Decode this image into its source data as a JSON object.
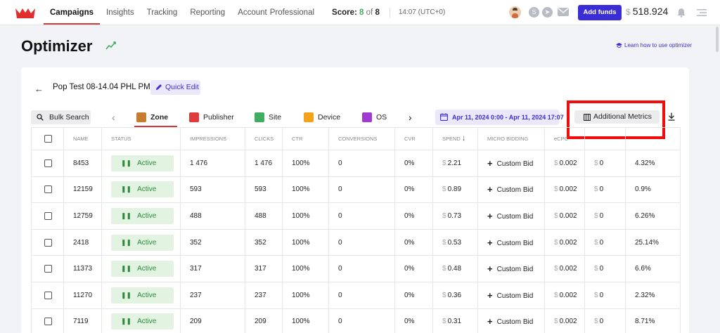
{
  "nav": {
    "items": [
      {
        "label": "Campaigns",
        "active": true
      },
      {
        "label": "Insights",
        "active": false
      },
      {
        "label": "Tracking",
        "active": false
      },
      {
        "label": "Reporting",
        "active": false
      }
    ],
    "account": {
      "label": "Account",
      "sub": "Professional"
    },
    "score": {
      "label": "Score:",
      "value": "8",
      "of": "of",
      "total": "8"
    },
    "time": "14:07 (UTC+0)",
    "social_icons": [
      "avatar",
      "skype-icon",
      "telegram-icon",
      "mail-icon"
    ],
    "add_funds_label": "Add funds",
    "balance": {
      "currency": "$",
      "amount": "518.924"
    },
    "accent_color": "#3b2dd6"
  },
  "page": {
    "title": "Optimizer",
    "learn_link": "Learn how to use optimizer"
  },
  "campaign": {
    "name": "Pop Test 08-14.04 PHL PM",
    "quick_edit_label": "Quick Edit"
  },
  "toolbar": {
    "bulk_search_label": "Bulk Search",
    "tabs": [
      {
        "label": "Zone",
        "icon": "zone-icon",
        "color": "#c77d2e",
        "active": true
      },
      {
        "label": "Publisher",
        "icon": "publisher-icon",
        "color": "#e03a3a",
        "active": false
      },
      {
        "label": "Site",
        "icon": "site-icon",
        "color": "#3fae62",
        "active": false
      },
      {
        "label": "Device",
        "icon": "device-icon",
        "color": "#f3a21b",
        "active": false
      },
      {
        "label": "OS",
        "icon": "os-icon",
        "color": "#a03ad0",
        "active": false
      }
    ],
    "date_range": "Apr 11, 2024 0:00 - Apr 11, 2024 17:07",
    "additional_metrics_label": "Additional Metrics",
    "highlight_color": "#f20d0d"
  },
  "table": {
    "headers": [
      "NAME",
      "STATUS",
      "IMPRESSIONS",
      "CLICKS",
      "CTR",
      "CONVERSIONS",
      "CVR",
      "SPEND",
      "MICRO BIDDING",
      "eCPC",
      "",
      ""
    ],
    "rows": [
      {
        "name": "8453",
        "status": "Active",
        "impressions": "1 476",
        "clicks": "1 476",
        "ctr": "100%",
        "conversions": "0",
        "cvr": "0%",
        "spend": "2.21",
        "bid": "Custom Bid",
        "ecpc": "0.002",
        "c11": "0",
        "c12": "4.32%"
      },
      {
        "name": "12159",
        "status": "Active",
        "impressions": "593",
        "clicks": "593",
        "ctr": "100%",
        "conversions": "0",
        "cvr": "0%",
        "spend": "0.89",
        "bid": "Custom Bid",
        "ecpc": "0.002",
        "c11": "0",
        "c12": "0.9%"
      },
      {
        "name": "12759",
        "status": "Active",
        "impressions": "488",
        "clicks": "488",
        "ctr": "100%",
        "conversions": "0",
        "cvr": "0%",
        "spend": "0.73",
        "bid": "Custom Bid",
        "ecpc": "0.002",
        "c11": "0",
        "c12": "6.26%"
      },
      {
        "name": "2418",
        "status": "Active",
        "impressions": "352",
        "clicks": "352",
        "ctr": "100%",
        "conversions": "0",
        "cvr": "0%",
        "spend": "0.53",
        "bid": "Custom Bid",
        "ecpc": "0.002",
        "c11": "0",
        "c12": "25.14%"
      },
      {
        "name": "11373",
        "status": "Active",
        "impressions": "317",
        "clicks": "317",
        "ctr": "100%",
        "conversions": "0",
        "cvr": "0%",
        "spend": "0.48",
        "bid": "Custom Bid",
        "ecpc": "0.002",
        "c11": "0",
        "c12": "6.6%"
      },
      {
        "name": "11270",
        "status": "Active",
        "impressions": "237",
        "clicks": "237",
        "ctr": "100%",
        "conversions": "0",
        "cvr": "0%",
        "spend": "0.36",
        "bid": "Custom Bid",
        "ecpc": "0.002",
        "c11": "0",
        "c12": "2.32%"
      },
      {
        "name": "7119",
        "status": "Active",
        "impressions": "209",
        "clicks": "209",
        "ctr": "100%",
        "conversions": "0",
        "cvr": "0%",
        "spend": "0.31",
        "bid": "Custom Bid",
        "ecpc": "0.002",
        "c11": "0",
        "c12": "8.71%"
      }
    ],
    "currency": "$"
  }
}
